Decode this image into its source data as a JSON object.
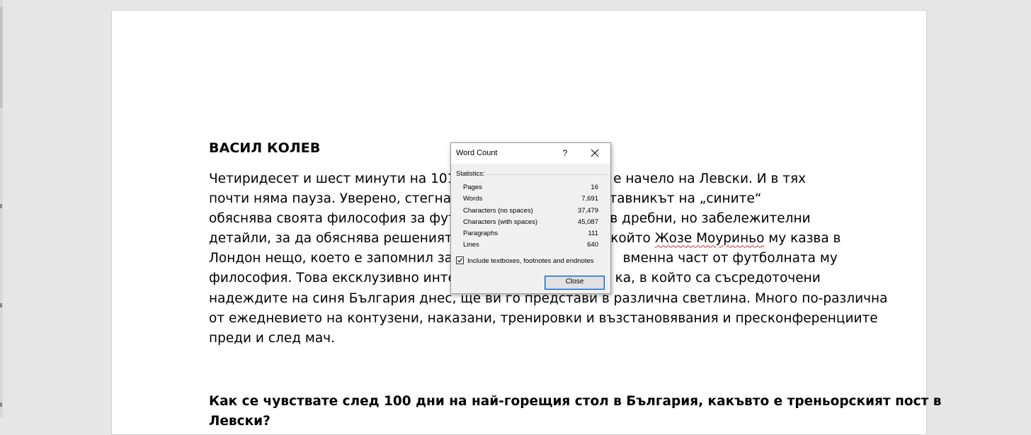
{
  "document": {
    "author": "ВАСИЛ КОЛЕВ",
    "paragraph_lines": [
      "Четиридесет и шест минути на 101-ия",
      "почти няма пауза. Уверено, стегнато,",
      "обяснява своята философия за футбол",
      "детайли, за да обяснява решенията си",
      "Лондон нещо, което е запомнил за ця",
      "философия. Това ексклузивно интерв",
      "надеждите на синя България днес, ще ви го представи в различна светлина. Много по-различна",
      "от ежедневието на контузени, наказани, тренировки и възстановявания и пресконференциите",
      "преди и след мач."
    ],
    "paragraph_right_fragments": [
      "Генчев е начело на Левски. И в тях",
      ", наставникът на „сините“",
      "в дребни, но забележителни",
      "който ",
      "вменна част от футболната му",
      "ка, в който са съсредоточени"
    ],
    "spell_flagged": "Жозе Моуриньо",
    "line4_tail": " му казва в",
    "question_lines": [
      "Как се чувствате след 100 дни на най-горещия стол в България, какъвто е треньорският пост в",
      "Левски?"
    ]
  },
  "dialog": {
    "title": "Word Count",
    "help_label": "?",
    "section_label": "Statistics:",
    "stats": [
      {
        "label": "Pages",
        "value": "16"
      },
      {
        "label": "Words",
        "value": "7,691"
      },
      {
        "label": "Characters (no spaces)",
        "value": "37,479"
      },
      {
        "label": "Characters (with spaces)",
        "value": "45,087"
      },
      {
        "label": "Paragraphs",
        "value": "111"
      },
      {
        "label": "Lines",
        "value": "640"
      }
    ],
    "include_label": "Include textboxes, footnotes and endnotes",
    "include_checked": true,
    "close_label": "Close"
  }
}
